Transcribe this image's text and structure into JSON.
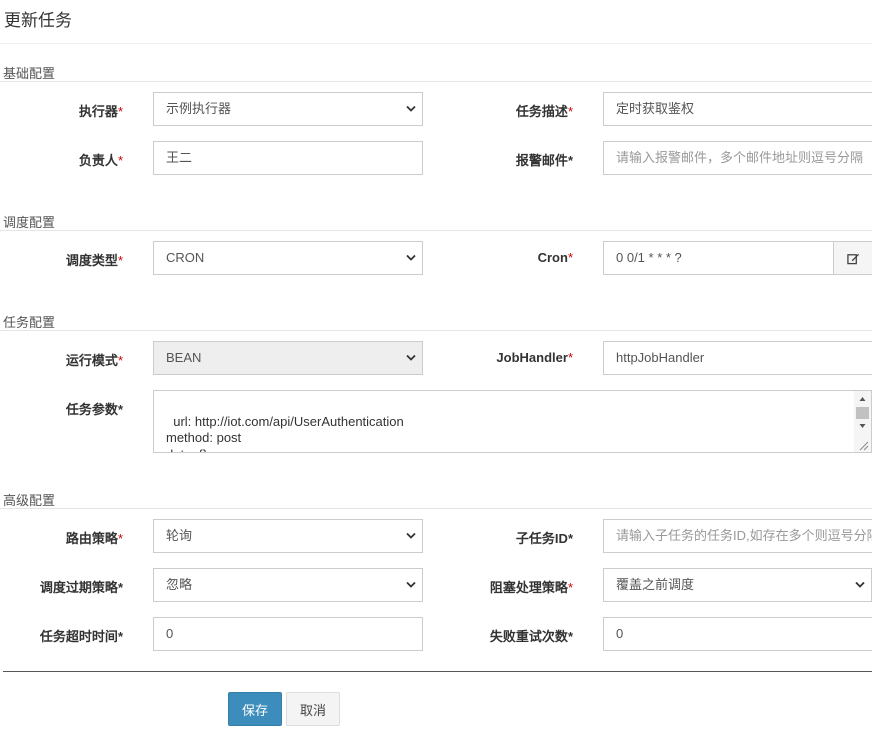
{
  "modal": {
    "title": "更新任务"
  },
  "sections": {
    "basic": "基础配置",
    "schedule": "调度配置",
    "task": "任务配置",
    "advanced": "高级配置"
  },
  "fields": {
    "executor": {
      "label": "执行器",
      "value": "示例执行器"
    },
    "job_desc": {
      "label": "任务描述",
      "value": "定时获取鉴权"
    },
    "author": {
      "label": "负责人",
      "value": "王二"
    },
    "alarm_email": {
      "label": "报警邮件",
      "placeholder": "请输入报警邮件，多个邮件地址则逗号分隔"
    },
    "schedule_type": {
      "label": "调度类型",
      "value": "CRON"
    },
    "cron": {
      "label": "Cron",
      "value": "0 0/1 * * * ?"
    },
    "run_mode": {
      "label": "运行模式",
      "value": "BEAN"
    },
    "job_handler": {
      "label": "JobHandler",
      "value": "httpJobHandler"
    },
    "job_param": {
      "label": "任务参数",
      "value": "url: http://iot.com/api/UserAuthentication\nmethod: post\ndata: {}"
    },
    "route_strategy": {
      "label": "路由策略",
      "value": "轮询"
    },
    "child_job_id": {
      "label": "子任务ID",
      "placeholder": "请输入子任务的任务ID,如存在多个则逗号分隔"
    },
    "misfire_strategy": {
      "label": "调度过期策略",
      "value": "忽略"
    },
    "block_strategy": {
      "label": "阻塞处理策略",
      "value": "覆盖之前调度"
    },
    "timeout": {
      "label": "任务超时时间",
      "value": "0"
    },
    "fail_retry": {
      "label": "失败重试次数",
      "value": "0"
    }
  },
  "required_mark": "*",
  "buttons": {
    "save": "保存",
    "cancel": "取消"
  },
  "colors": {
    "primary": "#3c8dbc",
    "required": "#cc0000"
  },
  "icons": {
    "cron_edit": "edit-icon",
    "select": "chevron-down-icon"
  }
}
